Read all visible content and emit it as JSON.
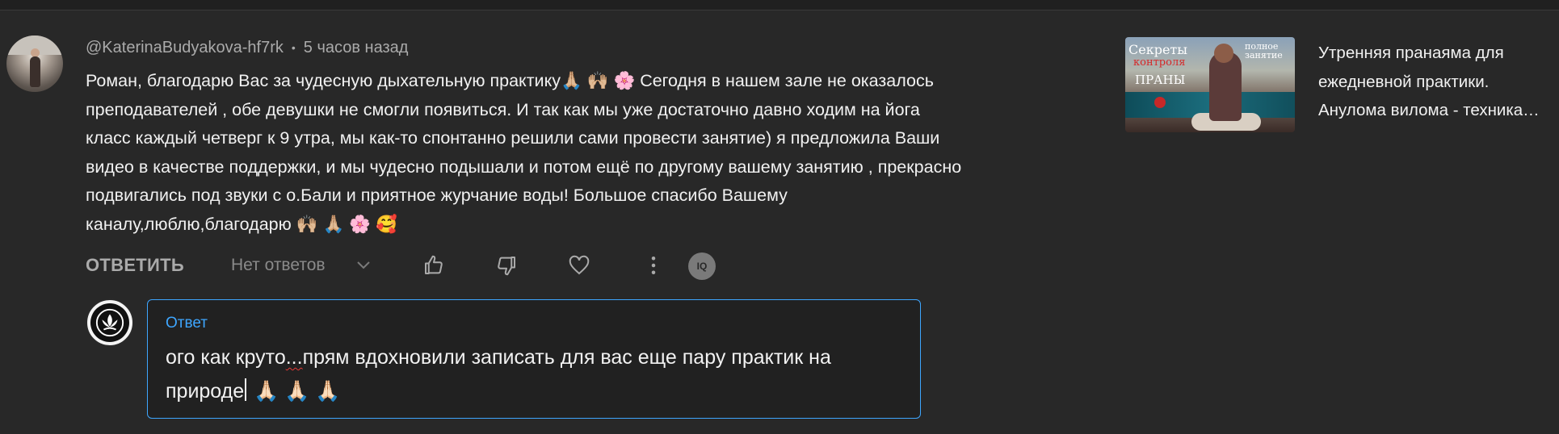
{
  "comment": {
    "author": "@KaterinaBudyakova-hf7rk",
    "separator": "•",
    "time": "5 часов назад",
    "text": "Роман, благодарю Вас за чудесную дыхательную практику🙏🏼 🙌🏼 🌸 Сегодня в нашем зале не оказалось\nпреподавателей , обе девушки не смогли появиться. И так как мы уже достаточно давно ходим на йога\nкласс каждый четверг к 9 утра, мы как-то спонтанно решили сами провести занятие) я предложила Ваши\nвидео в качестве поддержки, и мы чудесно подышали и потом ещё по другому вашему занятию , прекрасно\nподвигались под звуки с о.Бали и приятное журчание воды! Большое спасибо Вашему\nканалу,люблю,благодарю 🙌🏼 🙏🏼 🌸 🥰"
  },
  "actions": {
    "reply_label": "ОТВЕТИТЬ",
    "no_replies_label": "Нет ответов",
    "badge_text": "IQ"
  },
  "reply_editor": {
    "label": "Ответ",
    "text_before_typo": "ого как круто",
    "typo": "...",
    "text_after_typo": "прям вдохновили записать для вас еще пару практик на природе",
    "emojis": "🙏🏻 🙏🏻 🙏🏻"
  },
  "recommendation": {
    "thumb_title": "Секреты",
    "thumb_red": "контроля",
    "thumb_subtitle": "ПРАНЫ",
    "thumb_corner": "полное занятие",
    "title_lines": [
      "Утренняя пранаяма для",
      "ежедневной практики.",
      "Анулома вилома - техника…"
    ]
  },
  "colors": {
    "background": "#282828",
    "accent": "#3ea6ff",
    "muted_text": "#aaaaaa"
  }
}
